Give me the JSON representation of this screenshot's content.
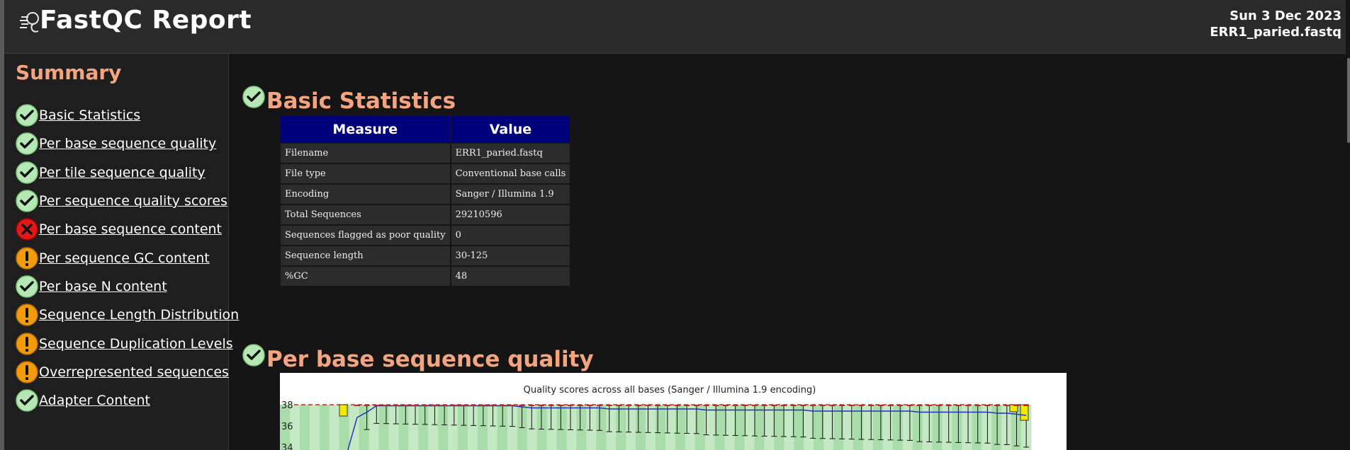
{
  "header": {
    "title": "FastQC Report",
    "date": "Sun 3 Dec 2023",
    "filename": "ERR1_paried.fastq"
  },
  "sidebar": {
    "heading": "Summary",
    "items": [
      {
        "label": "Basic Statistics",
        "status": "pass"
      },
      {
        "label": "Per base sequence quality",
        "status": "pass"
      },
      {
        "label": "Per tile sequence quality",
        "status": "pass"
      },
      {
        "label": "Per sequence quality scores",
        "status": "pass"
      },
      {
        "label": "Per base sequence content",
        "status": "fail"
      },
      {
        "label": "Per sequence GC content",
        "status": "warn"
      },
      {
        "label": "Per base N content",
        "status": "pass"
      },
      {
        "label": "Sequence Length Distribution",
        "status": "warn"
      },
      {
        "label": "Sequence Duplication Levels",
        "status": "warn"
      },
      {
        "label": "Overrepresented sequences",
        "status": "warn"
      },
      {
        "label": "Adapter Content",
        "status": "pass"
      }
    ]
  },
  "basic_statistics": {
    "title": "Basic Statistics",
    "status": "pass",
    "columns": [
      "Measure",
      "Value"
    ],
    "rows": [
      [
        "Filename",
        "ERR1_paried.fastq"
      ],
      [
        "File type",
        "Conventional base calls"
      ],
      [
        "Encoding",
        "Sanger / Illumina 1.9"
      ],
      [
        "Total Sequences",
        "29210596"
      ],
      [
        "Sequences flagged as poor quality",
        "0"
      ],
      [
        "Sequence length",
        "30-125"
      ],
      [
        "%GC",
        "48"
      ]
    ]
  },
  "per_base_quality": {
    "title": "Per base sequence quality",
    "status": "pass",
    "chart_title": "Quality scores across all bases (Sanger / Illumina 1.9 encoding)",
    "y_ticks": [
      "38",
      "36",
      "34"
    ]
  },
  "colors": {
    "accent": "#f4a580",
    "table_header": "#00007a",
    "pass": "#2e9b2e",
    "warn": "#f29b0d",
    "fail": "#dd1111"
  },
  "chart_data": {
    "type": "line",
    "title": "Quality scores across all bases (Sanger / Illumina 1.9 encoding)",
    "xlabel": "",
    "ylabel": "",
    "ylim": [
      34,
      38
    ],
    "yticks": [
      38,
      36,
      34
    ],
    "series": [
      {
        "values": [
          33.6,
          33.6,
          33.6,
          33.6,
          33.6,
          33.6,
          36.8,
          37.3,
          37.9,
          37.9,
          37.9,
          37.9,
          37.9,
          37.9,
          37.9,
          37.9,
          37.9,
          37.9,
          37.9,
          37.9,
          37.9,
          37.9,
          37.9,
          37.8,
          37.7,
          37.7,
          37.7,
          37.7,
          37.7,
          37.7,
          37.7,
          37.7,
          37.6,
          37.6,
          37.6,
          37.6,
          37.6,
          37.6,
          37.6,
          37.6,
          37.6,
          37.6,
          37.5,
          37.5,
          37.5,
          37.5,
          37.5,
          37.5,
          37.5,
          37.5,
          37.5,
          37.5,
          37.5,
          37.4,
          37.4,
          37.4,
          37.4,
          37.4,
          37.4,
          37.4,
          37.4,
          37.4,
          37.4,
          37.4,
          37.3,
          37.3,
          37.3,
          37.3,
          37.3,
          37.3,
          37.3,
          37.3,
          37.2,
          37.2,
          37.1,
          37.0
        ]
      }
    ],
    "grid": true
  }
}
